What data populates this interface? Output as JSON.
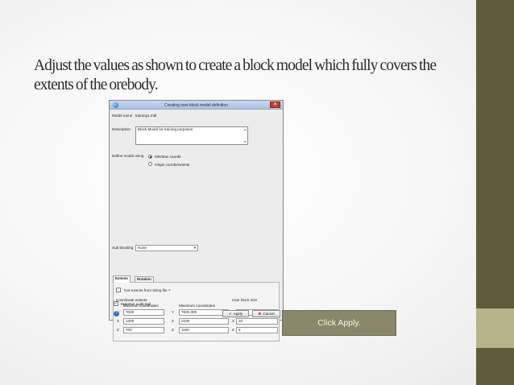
{
  "slide": {
    "title": "Adjust the values as shown to create a block model which fully covers the extents of the orebody.",
    "callout": "Click Apply."
  },
  "dialog": {
    "title": "Creating new block model definition",
    "close_icon": "✕",
    "model_name_label": "Model name",
    "model_name_value": "training1.mdl",
    "description_label": "Description",
    "description_value": "Block Model for training purposes",
    "define_label": "Define model using",
    "define_options": [
      "Min/Max coords",
      "Origin coords/extents"
    ],
    "define_selected": "Min/Max coords",
    "tabs": [
      "Extents",
      "Rotation"
    ],
    "active_tab": "Extents",
    "get_extents_label": "Get extents from string file ?",
    "coord_header": "Coordinate extents",
    "min_header": "Minimum coordinates",
    "max_header": "Maximum coordinates",
    "user_block_header": "User block size",
    "axes": [
      "Y",
      "X",
      "Z"
    ],
    "min_values": [
      "7000",
      "1200",
      "700"
    ],
    "max_values": [
      "7600.000",
      "2100",
      "1100"
    ],
    "block_values": [
      "10",
      "10",
      "5"
    ],
    "sub_blocking_label": "Sub blocking",
    "sub_blocking_value": "None",
    "audit_label": "Maintain audit trail",
    "audit_checked": true,
    "apply_label": "Apply",
    "cancel_label": "Cancel"
  },
  "colors": {
    "accent_dark": "#5f5b3b",
    "accent_light": "#b6b38a",
    "callout_bg": "#8b876a"
  }
}
